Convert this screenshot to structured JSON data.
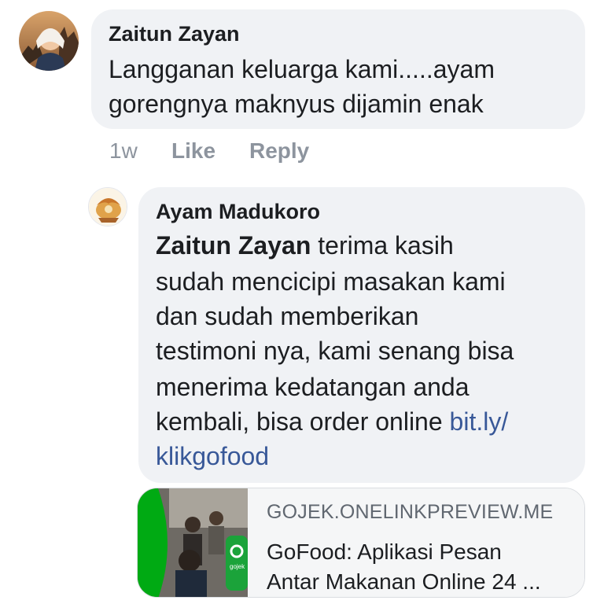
{
  "comment": {
    "author": "Zaitun Zayan",
    "text_line1": "Langganan keluarga kami.....ayam",
    "text_line2": "gorengnya maknyus dijamin enak",
    "avatar": "user-avatar-icon",
    "actions": {
      "time": "1w",
      "like": "Like",
      "reply": "Reply"
    }
  },
  "reply": {
    "author": "Ayam Madukoro",
    "avatar": "page-avatar-icon",
    "mention": "Zaitun Zayan",
    "line1_rest": " terima kasih",
    "line2": "sudah mencicipi masakan kami",
    "line3": "dan sudah memberikan",
    "line4": "testimoni nya, kami senang bisa",
    "line5": "menerima kedatangan anda",
    "line6_text": "kembali, bisa order online ",
    "link_part1": "bit.ly/",
    "link_part2": "klikgofood"
  },
  "link_preview": {
    "domain": "GOJEK.ONELINKPREVIEW.ME",
    "title_line1": "GoFood: Aplikasi Pesan",
    "title_line2": "Antar Makanan Online 24 ...",
    "thumbnail_text": "gojek",
    "colors": {
      "green": "#00aa13",
      "link": "#385898",
      "bubble": "#f0f2f5",
      "meta": "#8d949e"
    }
  }
}
